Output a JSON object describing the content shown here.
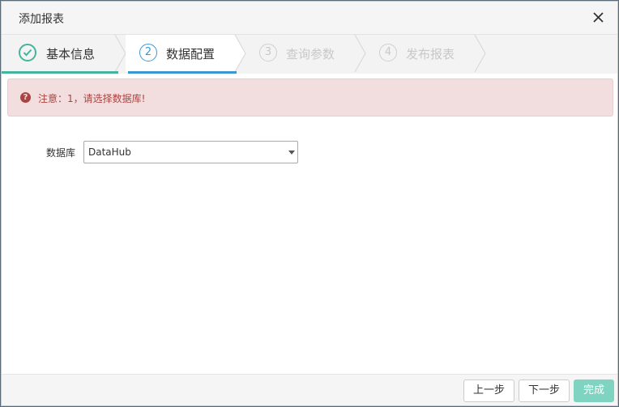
{
  "dialog": {
    "title": "添加报表"
  },
  "steps": [
    {
      "number": "1",
      "label": "基本信息",
      "state": "completed"
    },
    {
      "number": "2",
      "label": "数据配置",
      "state": "active"
    },
    {
      "number": "3",
      "label": "查询参数",
      "state": "pending"
    },
    {
      "number": "4",
      "label": "发布报表",
      "state": "pending"
    }
  ],
  "alert": {
    "message": "注意：1，请选择数据库!"
  },
  "form": {
    "database_label": "数据库",
    "database_value": "DataHub"
  },
  "footer": {
    "prev_label": "上一步",
    "next_label": "下一步",
    "finish_label": "完成"
  },
  "colors": {
    "completed": "#45b39d",
    "active": "#3a97d4",
    "pending": "#c8c8c8",
    "alert_text": "#a94442",
    "alert_bg": "#f2dede",
    "primary_button": "#7fd4c1"
  }
}
